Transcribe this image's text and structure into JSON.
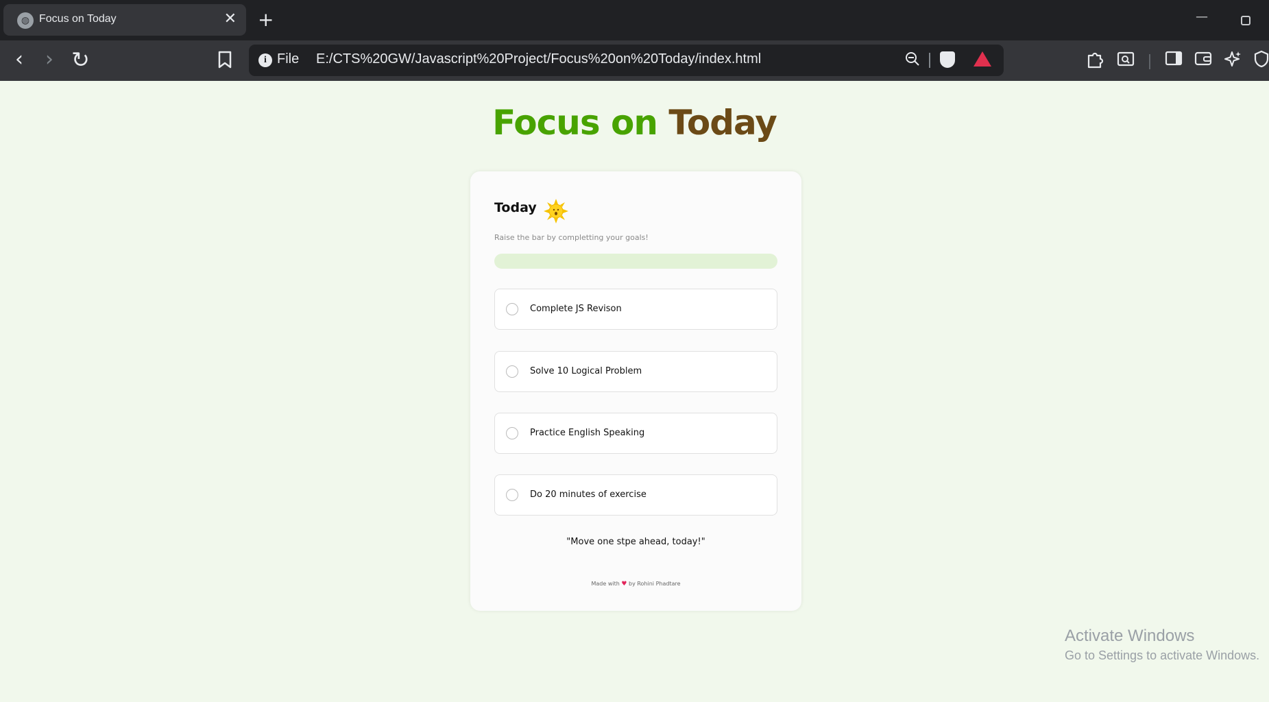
{
  "browser": {
    "tab_title": "Focus on Today",
    "tab_close": "✕",
    "new_tab": "+",
    "omnibox_scheme": "File",
    "url": "E:/CTS%20GW/Javascript%20Project/Focus%20on%20Today/index.html"
  },
  "page": {
    "title_part1": "Focus on",
    "title_part2": "Today"
  },
  "card": {
    "heading": "Today",
    "subtitle": "Raise the bar by completting your goals!",
    "progress": 0,
    "goals": [
      {
        "label": "Complete JS Revison",
        "done": false
      },
      {
        "label": "Solve 10 Logical Problem",
        "done": false
      },
      {
        "label": "Practice English Speaking",
        "done": false
      },
      {
        "label": "Do 20 minutes of exercise",
        "done": false
      }
    ],
    "quote": "\"Move one stpe ahead, today!\"",
    "footer_prefix": "Made with",
    "footer_suffix": "by Rohini Phadtare"
  },
  "watermark": {
    "title": "Activate Windows",
    "subtitle": "Go to Settings to activate Windows."
  },
  "colors": {
    "title_green": "#48a300",
    "title_brown": "#6b4a16",
    "progress_track": "#e2f2d6",
    "page_bg": "#f1f8ec"
  }
}
